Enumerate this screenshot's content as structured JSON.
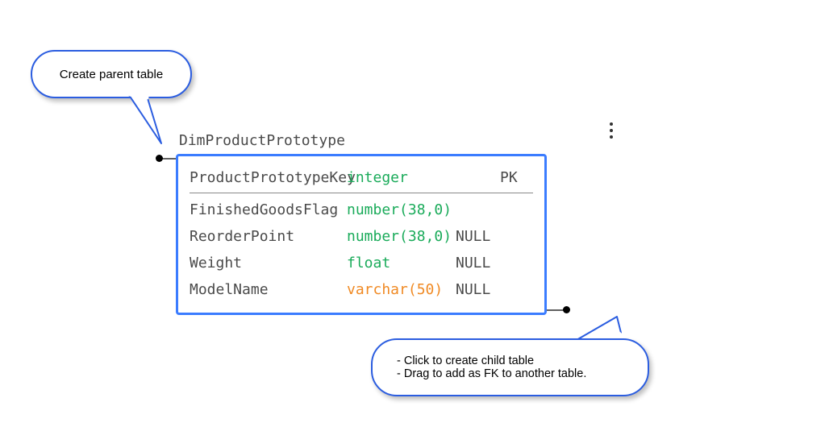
{
  "callout_parent": {
    "text": "Create parent table"
  },
  "callout_child": {
    "line1": "- Click to create child table",
    "line2": "- Drag to add as FK to another table."
  },
  "table": {
    "name": "DimProductPrototype",
    "pk_label": "PK",
    "columns": [
      {
        "name": "ProductPrototypeKey",
        "type": "integer",
        "type_color": "green",
        "nullable": "",
        "pk": true
      },
      {
        "name": "FinishedGoodsFlag",
        "type": "number(38,0)",
        "type_color": "green",
        "nullable": "",
        "pk": false
      },
      {
        "name": "ReorderPoint",
        "type": "number(38,0)",
        "type_color": "green",
        "nullable": "NULL",
        "pk": false
      },
      {
        "name": "Weight",
        "type": "float",
        "type_color": "green",
        "nullable": "NULL",
        "pk": false
      },
      {
        "name": "ModelName",
        "type": "varchar(50)",
        "type_color": "orange",
        "nullable": "NULL",
        "pk": false
      }
    ]
  },
  "icons": {
    "kebab": "more-options-icon",
    "parent_handle": "create-parent-handle",
    "child_handle": "create-child-handle"
  }
}
